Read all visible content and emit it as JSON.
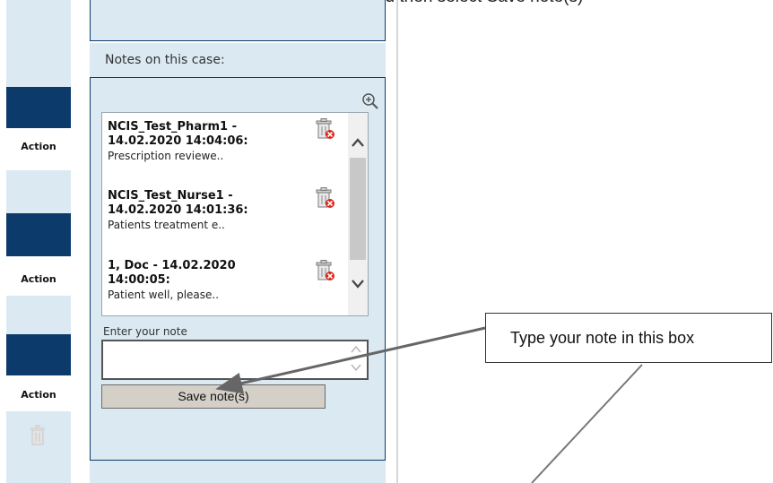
{
  "instruction_text": "Add your note by typing into the box and then select Save note(s)",
  "left_column": {
    "action_label": "Action"
  },
  "notes_panel": {
    "heading": "Notes on this case:",
    "notes": [
      {
        "title": "NCIS_Test_Pharm1 - 14.02.2020 14:04:06:",
        "text": "Prescription reviewe.."
      },
      {
        "title": "NCIS_Test_Nurse1 - 14.02.2020 14:01:36:",
        "text": "Patients treatment e.."
      },
      {
        "title": "1, Doc - 14.02.2020 14:00:05:",
        "text": "Patient well, please.."
      }
    ],
    "input_label": "Enter your note",
    "input_value": "",
    "save_label": "Save note(s)"
  },
  "callout": {
    "text": "Type your note in this box"
  },
  "icons": [
    "zoom-in-icon",
    "trash-icon",
    "scroll-up-icon",
    "scroll-down-icon"
  ],
  "colors": {
    "panel_bg": "#dbe9f3",
    "navy": "#0c3a6a",
    "button_bg": "#d4d0c8",
    "delete_red": "#d9261c"
  }
}
